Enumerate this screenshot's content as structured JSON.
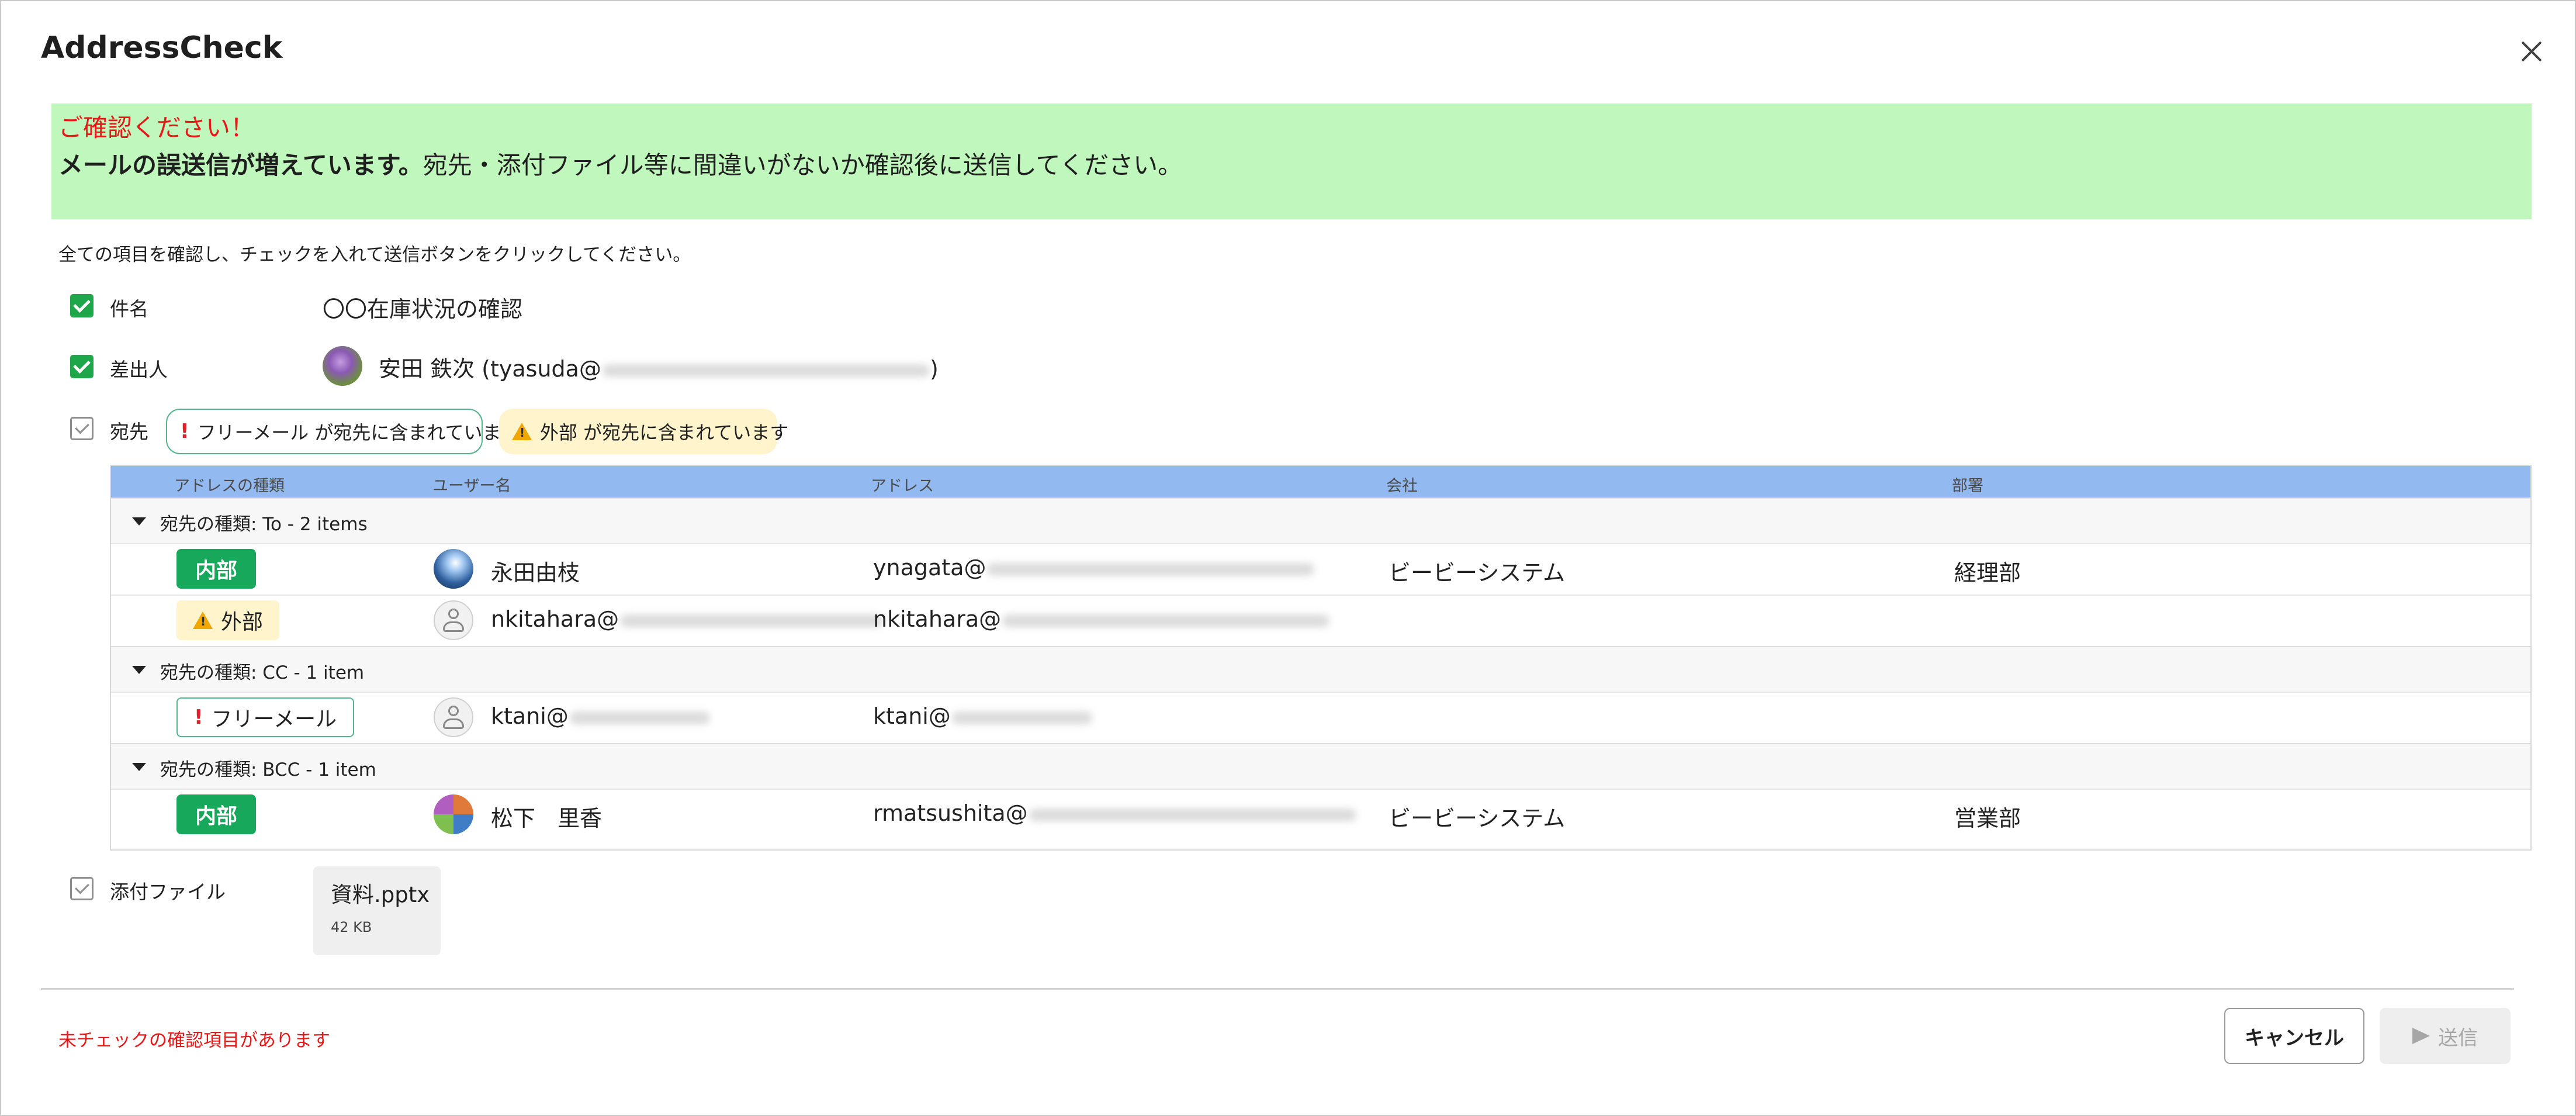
{
  "dialog": {
    "title": "AddressCheck",
    "close_icon": "close-icon"
  },
  "banner": {
    "warning": "ご確認ください！",
    "message_bold": "メールの誤送信が増えています。",
    "message": "宛先・添付ファイル等に間違いがないか確認後に送信してください。",
    "color": "#c0f7bc"
  },
  "instruction": "全ての項目を確認し、チェックを入れて送信ボタンをクリックしてください。",
  "subject": {
    "label": "件名",
    "value": "〇〇在庫状況の確認",
    "checked": true
  },
  "sender": {
    "label": "差出人",
    "name": "安田 鉄次 (tyasuda@",
    "suffix": ")",
    "checked": true
  },
  "recipients": {
    "label": "宛先",
    "checked": false,
    "warnings": [
      {
        "icon": "exclamation-icon",
        "text": "フリーメール が宛先に含まれています"
      },
      {
        "icon": "warning-triangle-icon",
        "text": "外部 が宛先に含まれています"
      }
    ],
    "columns": [
      "アドレスの種類",
      "ユーザー名",
      "アドレス",
      "会社",
      "部署"
    ],
    "groups": [
      {
        "label": "宛先の種類: To - 2 items",
        "rows": [
          {
            "type": "内部",
            "type_style": "internal",
            "avatar": "photo-avatar",
            "user": "永田由枝",
            "address": "ynagata@",
            "company": "ビービーシステム",
            "dept": "経理部"
          },
          {
            "type": "外部",
            "type_style": "external",
            "avatar": "default-user-icon",
            "user": "nkitahara@",
            "address": "nkitahara@",
            "company": "",
            "dept": ""
          }
        ]
      },
      {
        "label": "宛先の種類: CC - 1 item",
        "rows": [
          {
            "type": "フリーメール",
            "type_style": "freemail",
            "avatar": "default-user-icon",
            "user": "ktani@",
            "address": "ktani@",
            "company": "",
            "dept": ""
          }
        ]
      },
      {
        "label": "宛先の種類: BCC - 1 item",
        "rows": [
          {
            "type": "内部",
            "type_style": "internal",
            "avatar": "photo-avatar",
            "user": "松下　里香",
            "address": "rmatsushita@",
            "company": "ビービーシステム",
            "dept": "営業部"
          }
        ]
      }
    ]
  },
  "attachment": {
    "label": "添付ファイル",
    "checked": false,
    "file_name": "資料.pptx",
    "file_size": "42 KB"
  },
  "footer": {
    "error": "未チェックの確認項目があります",
    "cancel_label": "キャンセル",
    "send_label": "送信"
  },
  "colors": {
    "internal": "#17a85b",
    "external_bg": "#fff4cc",
    "header": "#93baf0",
    "error": "#e81818"
  }
}
